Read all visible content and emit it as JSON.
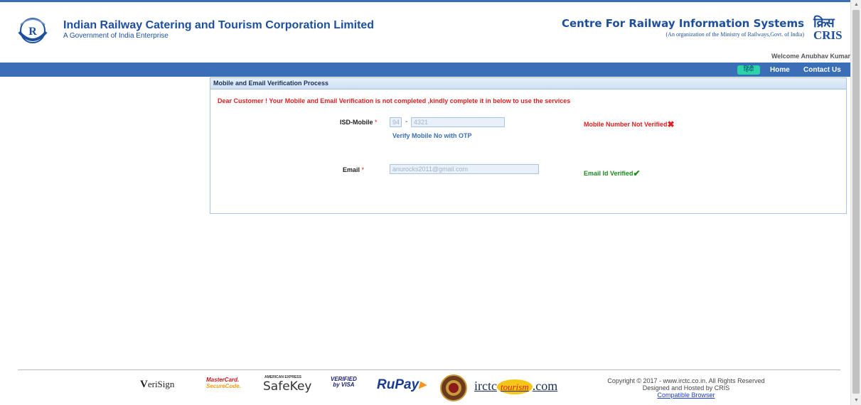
{
  "header": {
    "org_title": "Indian Railway Catering and Tourism Corporation Limited",
    "org_subtitle": "A Government of India Enterprise",
    "cris_title": "Centre For Railway Information Systems",
    "cris_subtitle": "(An organization of the Ministry of Railways,Govt. of India)",
    "cris_logo_hindi": "क्रिस",
    "cris_logo_text": "CRIS",
    "welcome": "Welcome Anubhav Kumar"
  },
  "nav": {
    "hindi": "हिंदी",
    "home": "Home",
    "contact": "Contact Us"
  },
  "panel": {
    "title": "Mobile and Email Verification Process",
    "notice": "Dear Customer ! Your Mobile and Email Verification is not completed ,kindly complete it in below to use the services",
    "mobile": {
      "label": "ISD-Mobile",
      "required_mark": "*",
      "isd_value": "94",
      "separator": "-",
      "number_value": "4321",
      "otp_link": "Verify Mobile No with OTP",
      "status": "Mobile Number Not Verified"
    },
    "email": {
      "label": "Email",
      "required_mark": "*",
      "value": "anurocks2011@gmail.com",
      "status": "Email Id Verified"
    }
  },
  "footer": {
    "brands": {
      "verisign_v": "V",
      "verisign_rest": "eriSign",
      "mastercard_line1": "MasterCard.",
      "mastercard_line2": "SecureCode.",
      "amex": "AMERICAN EXPRESS",
      "safekey": "SafeKey",
      "visa_line1": "VERIFIED",
      "visa_line2": "by VISA",
      "rupay": "RuPay",
      "irctc": "irctc",
      "tourism": "tourism",
      "dotcom": ".com"
    },
    "copyright": "Copyright © 2017 - www.irctc.co.in. All Rights Reserved",
    "hosted": "Designed and Hosted by CRIS",
    "compatible": "Compatible Browser"
  },
  "colors": {
    "brand_blue": "#1d4f9c",
    "nav_blue": "#3a6fb7",
    "error_red": "#e02020",
    "success_green": "#1f8a1f"
  }
}
